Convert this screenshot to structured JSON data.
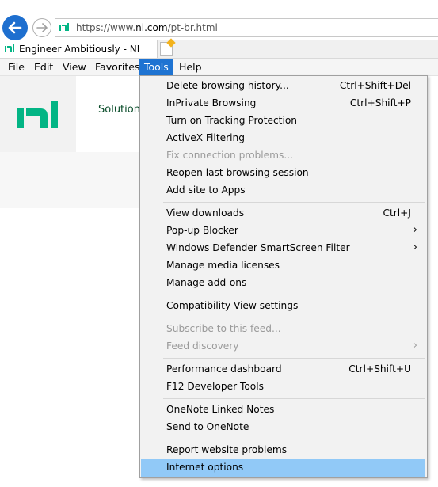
{
  "browser": {
    "url_prefix": "https://www.",
    "url_domain": "ni.com",
    "url_path": "/pt-br.html",
    "tab_title": "Engineer Ambitiously - NI"
  },
  "menubar": {
    "file": "File",
    "edit": "Edit",
    "view": "View",
    "favorites": "Favorites",
    "tools": "Tools",
    "help": "Help"
  },
  "page": {
    "solutions_text": "Solution"
  },
  "tools_menu": {
    "items": [
      {
        "label": "Delete browsing history...",
        "shortcut": "Ctrl+Shift+Del"
      },
      {
        "label": "InPrivate Browsing",
        "shortcut": "Ctrl+Shift+P"
      },
      {
        "label": "Turn on Tracking Protection",
        "shortcut": ""
      },
      {
        "label": "ActiveX Filtering",
        "shortcut": ""
      },
      {
        "label": "Fix connection problems...",
        "shortcut": ""
      },
      {
        "label": "Reopen last browsing session",
        "shortcut": ""
      },
      {
        "label": "Add site to Apps",
        "shortcut": ""
      },
      {
        "label": "View downloads",
        "shortcut": "Ctrl+J"
      },
      {
        "label": "Pop-up Blocker",
        "shortcut": ""
      },
      {
        "label": "Windows Defender SmartScreen Filter",
        "shortcut": ""
      },
      {
        "label": "Manage media licenses",
        "shortcut": ""
      },
      {
        "label": "Manage add-ons",
        "shortcut": ""
      },
      {
        "label": "Compatibility View settings",
        "shortcut": ""
      },
      {
        "label": "Subscribe to this feed...",
        "shortcut": ""
      },
      {
        "label": "Feed discovery",
        "shortcut": ""
      },
      {
        "label": "Performance dashboard",
        "shortcut": "Ctrl+Shift+U"
      },
      {
        "label": "F12 Developer Tools",
        "shortcut": ""
      },
      {
        "label": "OneNote Linked Notes",
        "shortcut": ""
      },
      {
        "label": "Send to OneNote",
        "shortcut": ""
      },
      {
        "label": "Report website problems",
        "shortcut": ""
      },
      {
        "label": "Internet options",
        "shortcut": ""
      }
    ],
    "submenu_arrow": "›"
  },
  "colors": {
    "accent": "#1e73d2",
    "highlight": "#91c9f7",
    "ni_green": "#03b585"
  }
}
